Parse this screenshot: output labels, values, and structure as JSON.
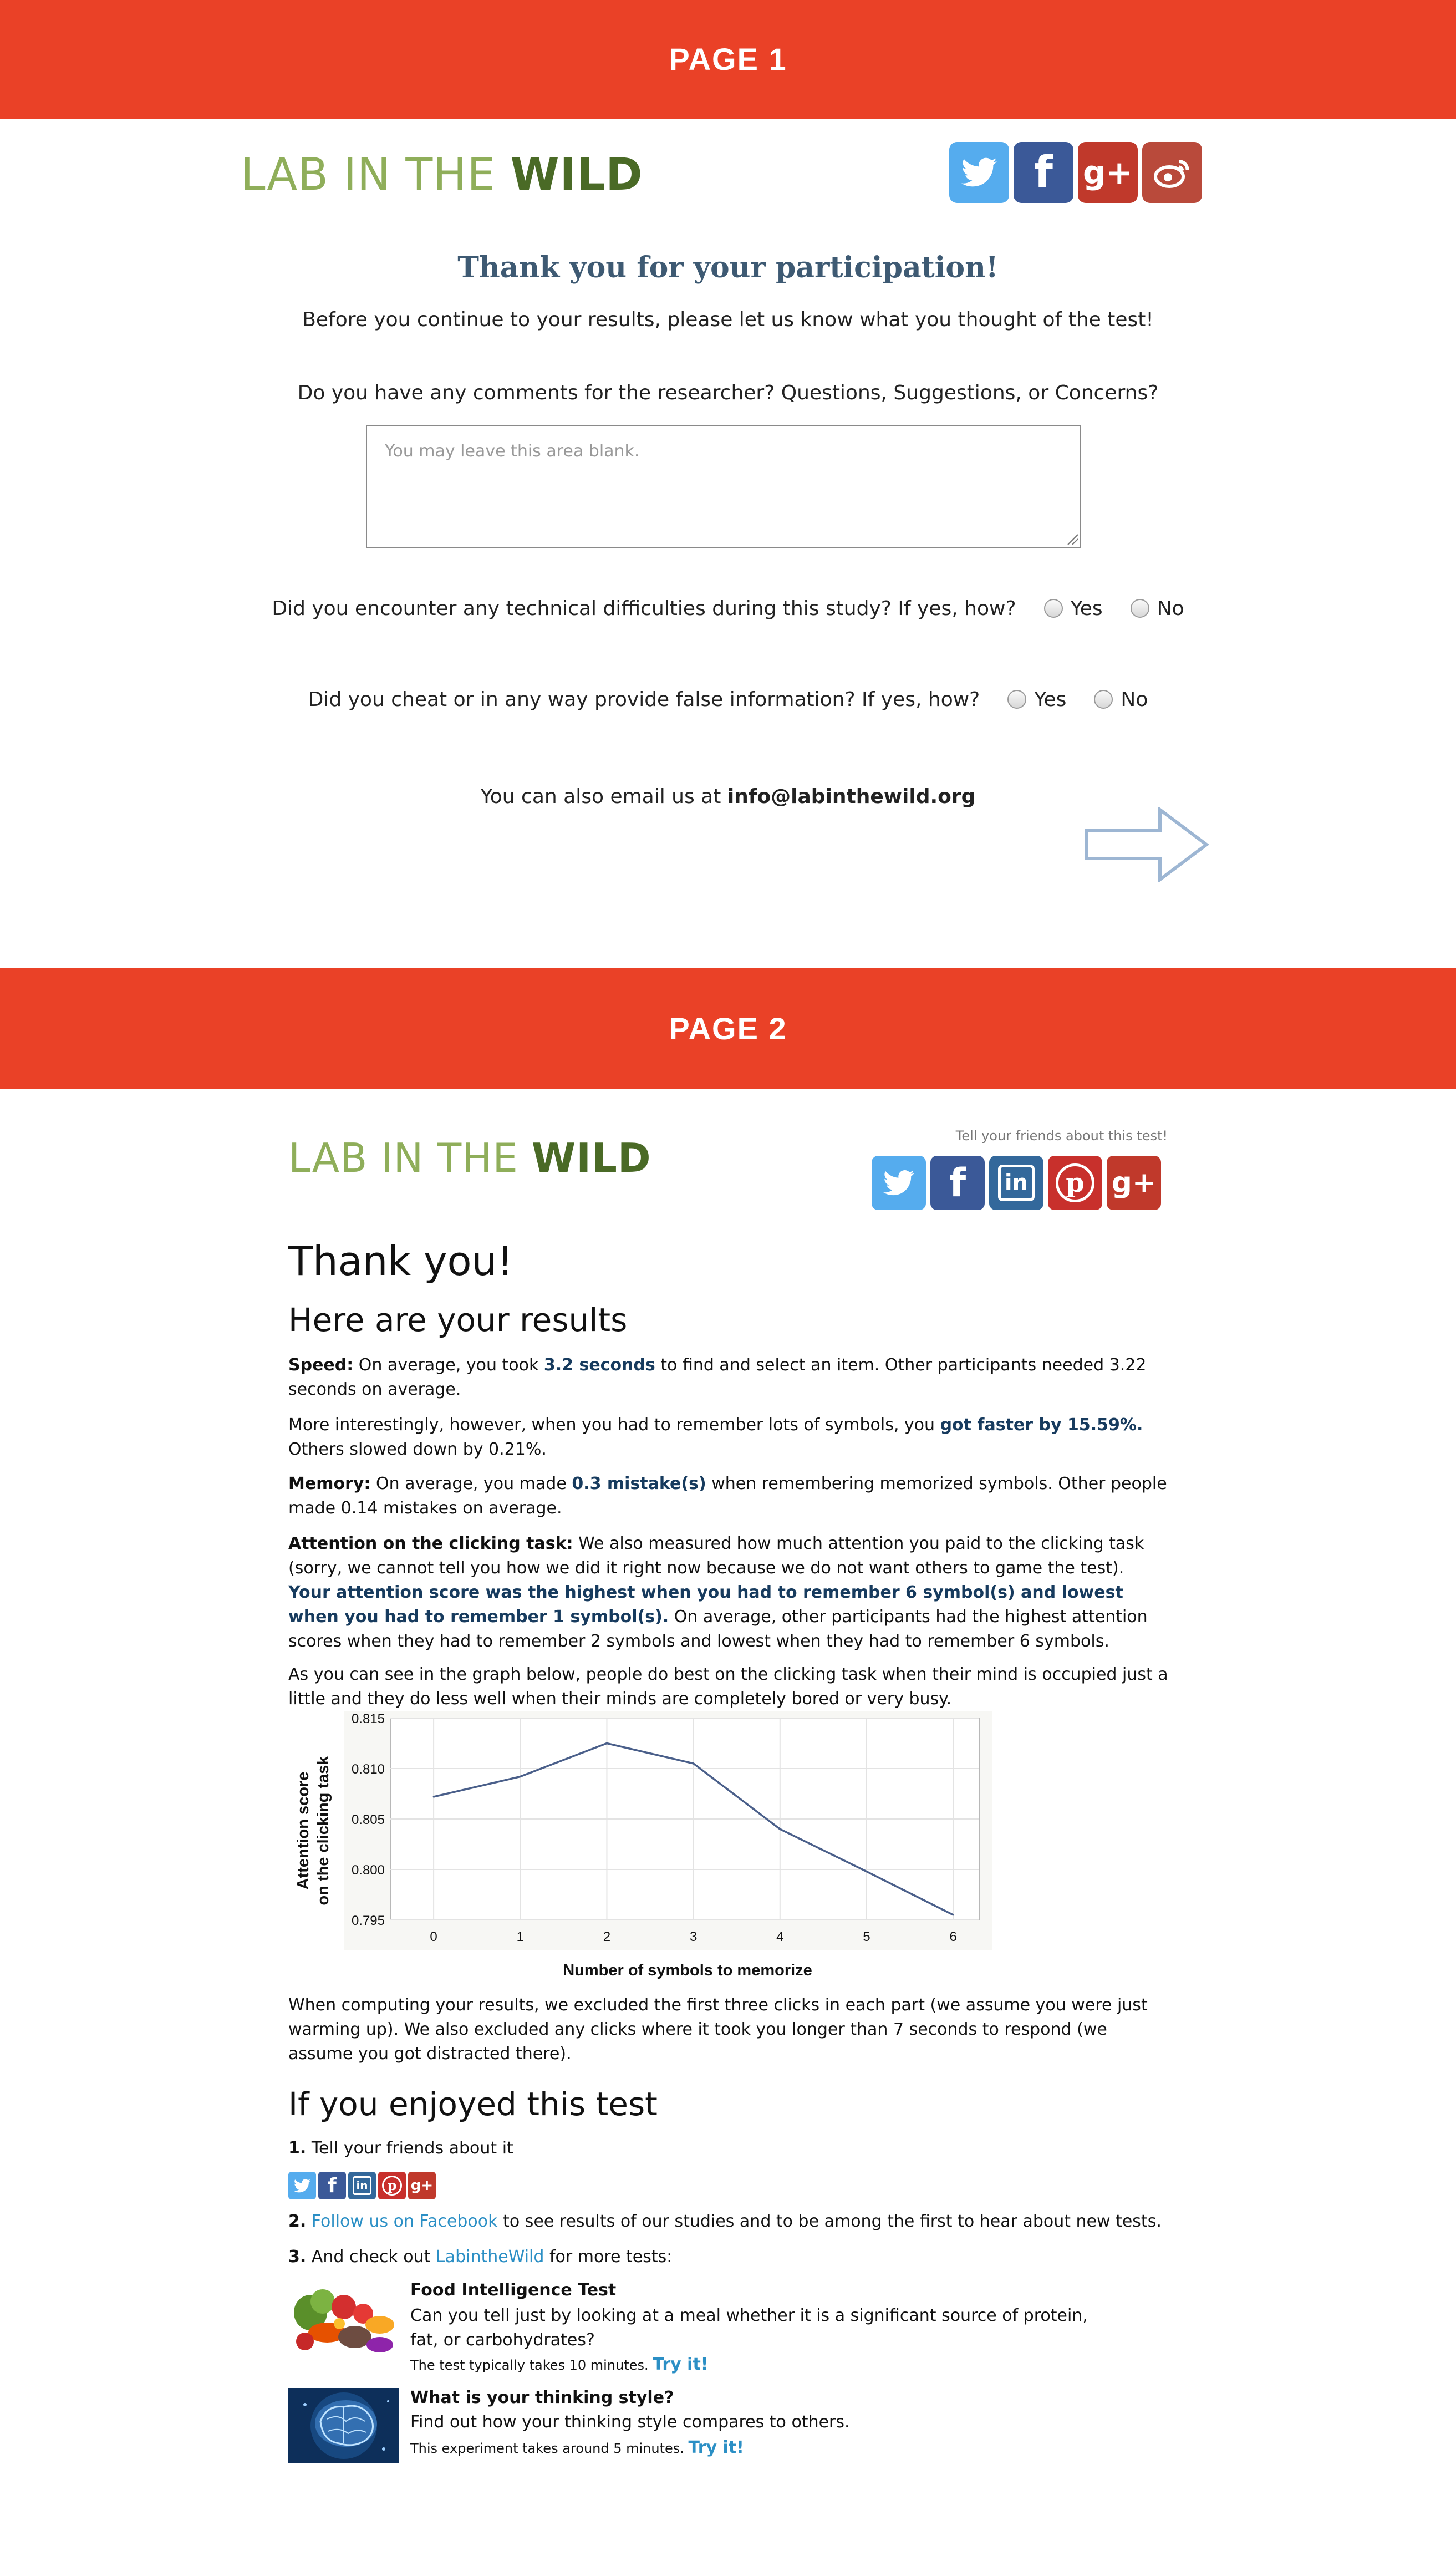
{
  "page1": {
    "banner": "PAGE 1",
    "logo": {
      "part1": "LAB IN THE ",
      "part2": "WILD"
    },
    "social_icons": [
      "twitter-icon",
      "facebook-icon",
      "google-plus-icon",
      "weibo-icon"
    ],
    "title": "Thank you for your participation!",
    "intro": "Before you continue to your results, please let us know what you thought of the test!",
    "comments_question": "Do you have any comments for the researcher? Questions, Suggestions, or Concerns?",
    "comments_placeholder": "You may leave this area blank.",
    "difficulties_question": "Did you encounter any technical difficulties during this study? If yes, how?",
    "cheat_question": "Did you cheat or in any way provide false information? If yes, how?",
    "yes_label": "Yes",
    "no_label": "No",
    "email_prefix": "You can also email us at ",
    "email": "info@labinthewild.org"
  },
  "page2": {
    "banner": "PAGE 2",
    "logo": {
      "part1": "LAB IN THE ",
      "part2": "WILD"
    },
    "tell_friends": "Tell your friends about this test!",
    "social_icons": [
      "twitter-icon",
      "facebook-icon",
      "linkedin-icon",
      "pinterest-icon",
      "google-plus-icon"
    ],
    "thank_you": "Thank you!",
    "results_heading": "Here are your results",
    "speed": {
      "label": "Speed:",
      "pre": " On average, you took ",
      "value": "3.2 seconds",
      "post": " to find and select an item. Other participants needed 3.22 seconds on average."
    },
    "faster": {
      "pre": "More interestingly, however, when you had to remember lots of symbols, you ",
      "value": "got faster by 15.59%.",
      "post": " Others slowed down by 0.21%."
    },
    "memory": {
      "label": "Memory:",
      "pre": " On average, you made ",
      "value": "0.3 mistake(s)",
      "post": " when remembering memorized symbols. Other people made 0.14 mistakes on average."
    },
    "attention": {
      "label": "Attention on the clicking task:",
      "pre": " We also measured how much attention you paid to the clicking task (sorry, we cannot tell you how we did it right now because we do not want others to game the test). ",
      "value": "Your attention score was the highest when you had to remember 6 symbol(s) and lowest when you had to remember 1 symbol(s).",
      "post": " On average, other participants had the highest attention scores when they had to remember 2 symbols and lowest when they had to remember 6 symbols."
    },
    "graph_intro": "As you can see in the graph below, people do best on the clicking task when their mind is occupied just a little and they do less well when their minds are completely bored or very busy.",
    "excluded_note": "When computing your results, we excluded the first three clicks in each part (we assume you were just warming up). We also excluded any clicks where it took you longer than 7 seconds to respond (we assume you got distracted there).",
    "enjoyed_heading": "If you enjoyed this test",
    "step1": {
      "num": "1.",
      "text": " Tell your friends about it"
    },
    "step2": {
      "num": "2.",
      "link": "Follow us on Facebook",
      "text": " to see results of our studies and to be among the first to hear about new tests."
    },
    "step3": {
      "num": "3.",
      "pre": " And check out ",
      "link": "LabintheWild",
      "post": " for more tests:"
    },
    "tests": [
      {
        "title": "Food Intelligence Test",
        "description": "Can you tell just by looking at a meal whether it is a significant source of protein, fat, or carbohydrates?",
        "duration": "The test typically takes 10 minutes.",
        "cta": "Try it!"
      },
      {
        "title": "What is your thinking style?",
        "description": "Find out how your thinking style compares to others.",
        "duration": "This experiment takes around 5 minutes.",
        "cta": "Try it!"
      }
    ]
  },
  "chart_data": {
    "type": "line",
    "x": [
      0,
      1,
      2,
      3,
      4,
      5,
      6
    ],
    "series": [
      {
        "values": [
          0.8072,
          0.8092,
          0.8125,
          0.8105,
          0.804,
          0.7998,
          0.7955
        ]
      }
    ],
    "xlabel": "Number of symbols to memorize",
    "ylabel_line1": "Attention score",
    "ylabel_line2": "on the clicking task",
    "xlim": [
      -0.5,
      6.3
    ],
    "ylim": [
      0.795,
      0.815
    ],
    "yticks": [
      "0.795",
      "0.800",
      "0.805",
      "0.810",
      "0.815"
    ],
    "xticks": [
      "0",
      "1",
      "2",
      "3",
      "4",
      "5",
      "6"
    ],
    "grid": true,
    "line_color": "#4a5f8a"
  }
}
